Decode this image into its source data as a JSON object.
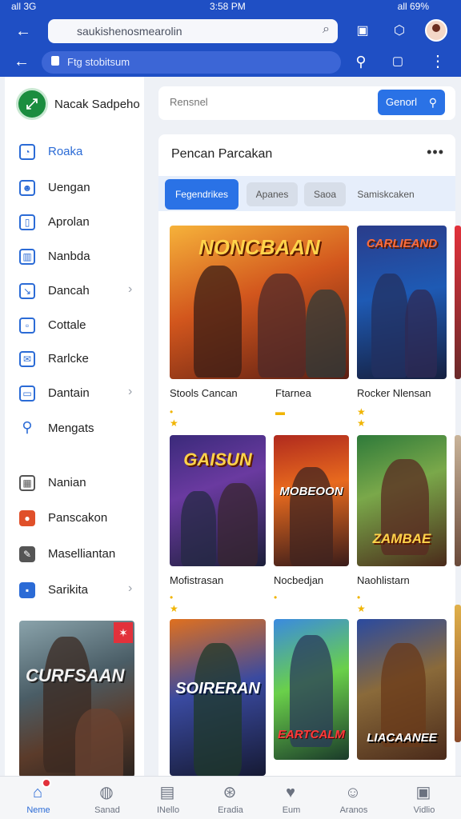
{
  "status": {
    "left": "all 3G",
    "time": "3:58 PM",
    "right": "all 69%"
  },
  "browser": {
    "url_text": "saukishenosmearolin",
    "address_text": "Ftg stobitsum",
    "icons": [
      "back-arrow-icon",
      "tab-icon",
      "share-icon",
      "profile-icon",
      "search-icon",
      "window-icon",
      "more-icon"
    ]
  },
  "sidebar": {
    "brand": "Nacak Sadpeho",
    "items": [
      {
        "label": "Roaka",
        "icon": "user-icon",
        "active": true,
        "chevron": false
      },
      {
        "label": "Uengan",
        "icon": "person-icon",
        "active": false,
        "chevron": false
      },
      {
        "label": "Aprolan",
        "icon": "phone-icon",
        "active": false,
        "chevron": false
      },
      {
        "label": "Nanbda",
        "icon": "calendar-icon",
        "active": false,
        "chevron": false
      },
      {
        "label": "Dancah",
        "icon": "chart-icon",
        "active": false,
        "chevron": true
      },
      {
        "label": "Cottale",
        "icon": "folder-icon",
        "active": false,
        "chevron": false
      },
      {
        "label": "Rarlcke",
        "icon": "mail-icon",
        "active": false,
        "chevron": false
      },
      {
        "label": "Dantain",
        "icon": "window-icon",
        "active": false,
        "chevron": true
      },
      {
        "label": "Mengats",
        "icon": "search-icon",
        "active": false,
        "chevron": false
      },
      {
        "label": "Nanian",
        "icon": "grid-icon",
        "active": false,
        "chevron": false
      },
      {
        "label": "Panscakon",
        "icon": "record-icon",
        "active": false,
        "chevron": false
      },
      {
        "label": "Maselliantan",
        "icon": "tool-icon",
        "active": false,
        "chevron": false
      },
      {
        "label": "Sarikita",
        "icon": "chat-icon",
        "active": false,
        "chevron": true
      }
    ],
    "banner_title": "CURFSAAN"
  },
  "search": {
    "placeholder": "Rensnel",
    "button": "Genorl"
  },
  "panel": {
    "title": "Pencan Parcakan",
    "more": "•••",
    "tabs": [
      "Fegendrikes",
      "Apanes",
      "Saoa",
      "Samiskcaken"
    ]
  },
  "games": [
    {
      "title": "NONCBAAN",
      "caption": "Stools Cancan",
      "stars": "• ★"
    },
    {
      "title": "CARLIEAND",
      "caption": "Rocker Nlensan",
      "stars": "★ ★"
    },
    {
      "title": "GAISUN",
      "caption": "Mofistrasan",
      "stars": "• ★"
    },
    {
      "title": "MOBEOON",
      "caption": "Nocbedjan",
      "stars": "•"
    },
    {
      "title": "ZAMBAE",
      "caption": "Naohlistarn",
      "stars": "• ★"
    },
    {
      "title": "SOIRERAN",
      "caption": "",
      "stars": ""
    },
    {
      "title": "EARTCALM",
      "caption": "",
      "stars": ""
    },
    {
      "title": "LIACAANEE",
      "caption": "",
      "stars": ""
    }
  ],
  "extra_captions": {
    "middle_top": "Ftarnea",
    "middle_top_stars": "▬"
  },
  "bottom_nav": [
    {
      "label": "Neme",
      "icon": "home-icon",
      "active": true
    },
    {
      "label": "Sanad",
      "icon": "globe-icon",
      "active": false
    },
    {
      "label": "INello",
      "icon": "window-icon",
      "active": false
    },
    {
      "label": "Eradia",
      "icon": "compass-icon",
      "active": false
    },
    {
      "label": "Eum",
      "icon": "heart-icon",
      "active": false
    },
    {
      "label": "Aranos",
      "icon": "person-icon",
      "active": false
    },
    {
      "label": "Vidlio",
      "icon": "image-icon",
      "active": false
    }
  ]
}
